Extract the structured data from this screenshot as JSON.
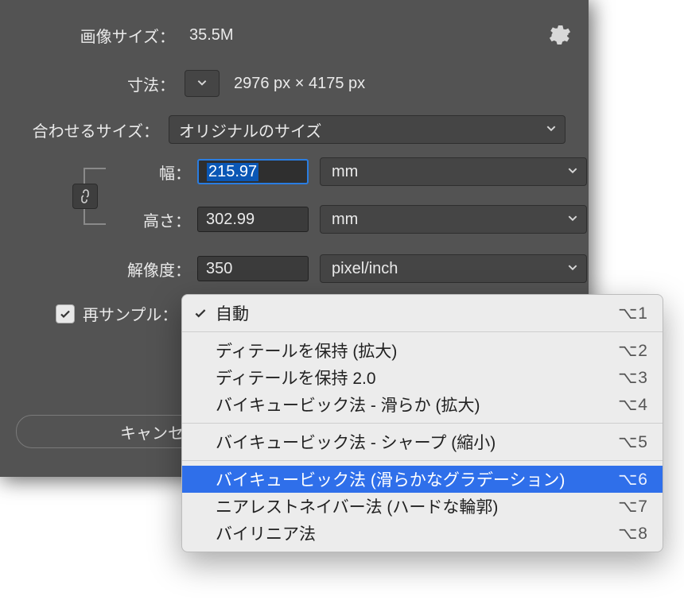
{
  "labels": {
    "image_size": "画像サイズ：",
    "dimensions": "寸法：",
    "fit_to": "合わせるサイズ：",
    "width": "幅：",
    "height": "高さ：",
    "resolution": "解像度：",
    "resample": "再サンプル："
  },
  "image_size_value": "35.5M",
  "dimensions_value": "2976 px × 4175 px",
  "fit_to_value": "オリジナルのサイズ",
  "width_value": "215.97",
  "width_unit": "mm",
  "height_value": "302.99",
  "height_unit": "mm",
  "resolution_value": "350",
  "resolution_unit": "pixel/inch",
  "resample_checked": true,
  "buttons": {
    "cancel": "キャンセ"
  },
  "menu": {
    "items": [
      {
        "label": "自動",
        "shortcut": "⌥1",
        "checked": true
      },
      {
        "sep": true
      },
      {
        "label": "ディテールを保持 (拡大)",
        "shortcut": "⌥2"
      },
      {
        "label": "ディテールを保持 2.0",
        "shortcut": "⌥3"
      },
      {
        "label": "バイキュービック法 - 滑らか (拡大)",
        "shortcut": "⌥4"
      },
      {
        "sep": true
      },
      {
        "label": "バイキュービック法 - シャープ (縮小)",
        "shortcut": "⌥5"
      },
      {
        "sep": true
      },
      {
        "label": "バイキュービック法 (滑らかなグラデーション)",
        "shortcut": "⌥6",
        "selected": true
      },
      {
        "label": "ニアレストネイバー法 (ハードな輪郭)",
        "shortcut": "⌥7"
      },
      {
        "label": "バイリニア法",
        "shortcut": "⌥8"
      }
    ]
  },
  "colors": {
    "panel": "#535353",
    "accent": "#2f6fea",
    "input_focus": "#2a7de1"
  }
}
